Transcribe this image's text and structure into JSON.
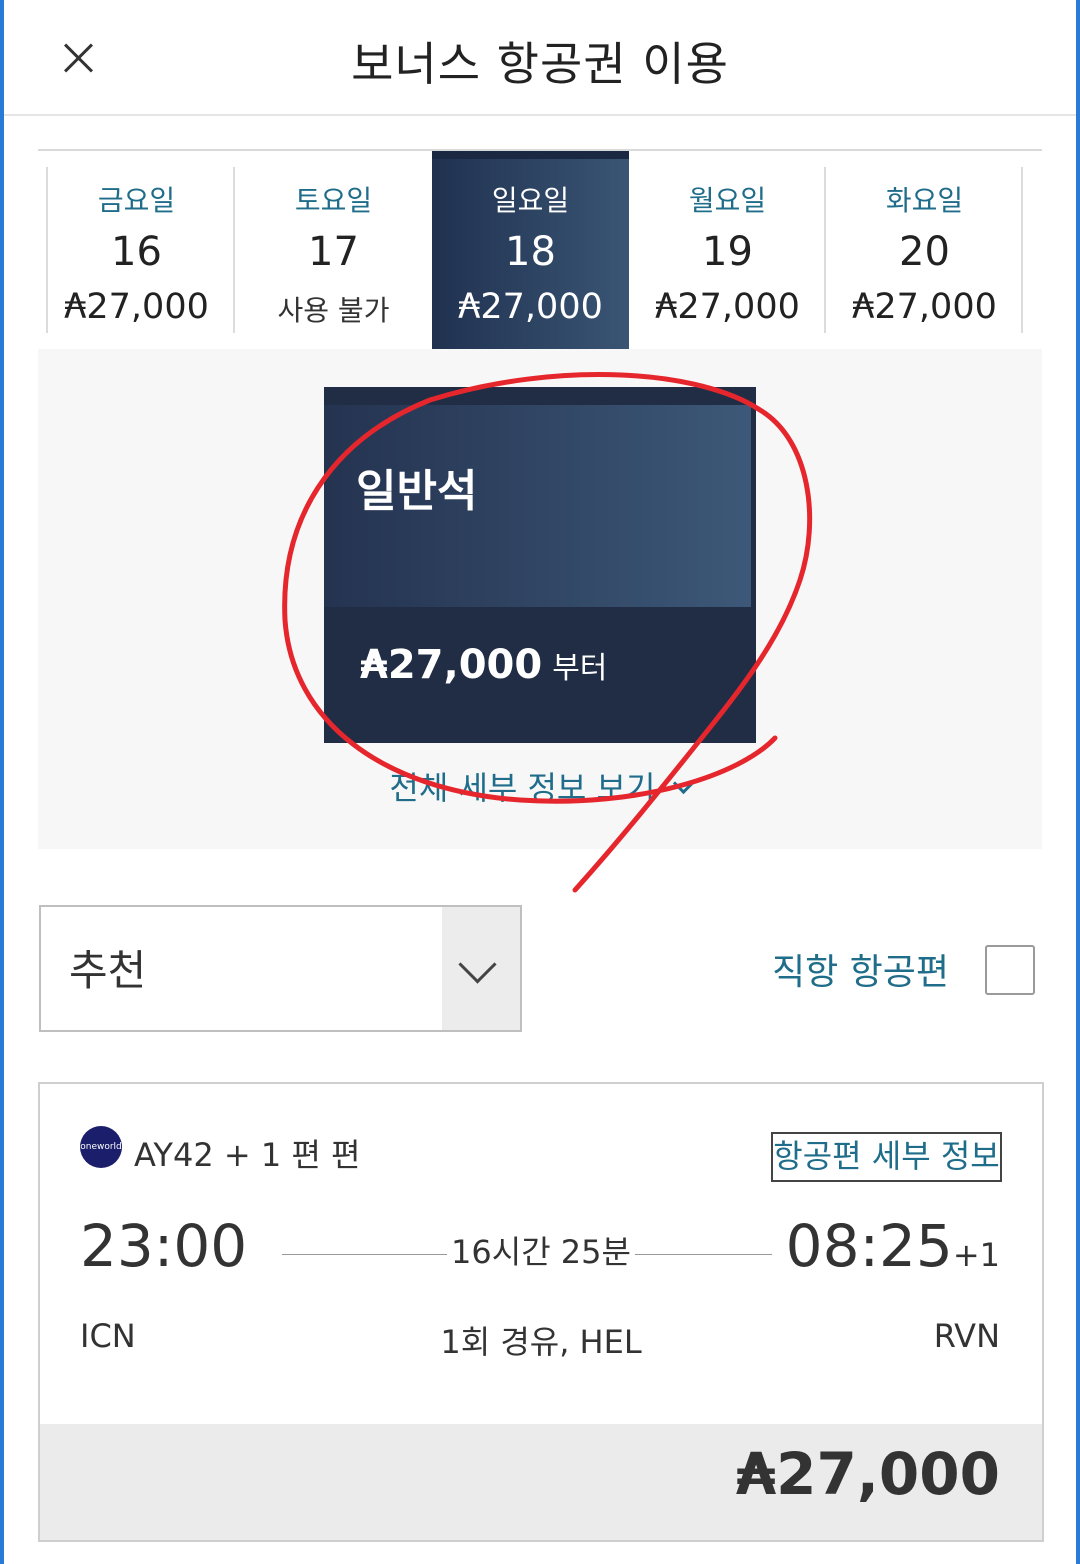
{
  "header": {
    "title": "보너스 항공권 이용"
  },
  "dates": [
    {
      "day": "금요일",
      "date": "16",
      "price": "₳27,000",
      "available": true,
      "selected": false
    },
    {
      "day": "토요일",
      "date": "17",
      "price": "사용 불가",
      "available": false,
      "selected": false
    },
    {
      "day": "일요일",
      "date": "18",
      "price": "₳27,000",
      "available": true,
      "selected": true
    },
    {
      "day": "월요일",
      "date": "19",
      "price": "₳27,000",
      "available": true,
      "selected": false
    },
    {
      "day": "화요일",
      "date": "20",
      "price": "₳27,000",
      "available": true,
      "selected": false
    }
  ],
  "cabin": {
    "name": "일반석",
    "price": "₳27,000",
    "price_suffix": "부터",
    "details_link": "전체 세부 정보 보기"
  },
  "sort": {
    "value": "추천"
  },
  "direct_filter": {
    "label": "직항 항공편",
    "checked": false
  },
  "flight": {
    "logo_text": "oneworld",
    "flight_number": "AY42 + 1 편 편",
    "details_button": "항공편 세부 정보",
    "departure_time": "23:00",
    "arrival_time": "08:25",
    "arrival_day_offset": "+1",
    "duration": "16시간 25분",
    "departure_airport": "ICN",
    "arrival_airport": "RVN",
    "stops": "1회 경유, HEL",
    "price": "₳27,000"
  },
  "colors": {
    "accent_teal": "#1f6d8a",
    "selected_navy": "#212d44",
    "annotation_red": "#e5272d",
    "frame_blue": "#2a7bd6"
  }
}
